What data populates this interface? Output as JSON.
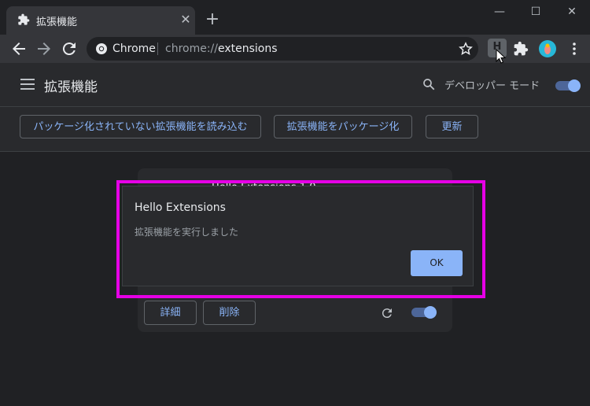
{
  "tab": {
    "title": "拡張機能",
    "close": "✕",
    "new_tab": "+"
  },
  "window_controls": {
    "minimize": "—",
    "maximize": "☐",
    "close": "✕"
  },
  "omnibox": {
    "label": "Chrome",
    "url_prefix": "chrome://",
    "url_path": "extensions"
  },
  "toolbar": {
    "extension_letter": "H"
  },
  "header": {
    "title": "拡張機能",
    "dev_mode_label": "デベロッパー モード",
    "dev_mode_on": true
  },
  "subbar": {
    "load_unpacked": "パッケージ化されていない拡張機能を読み込む",
    "pack": "拡張機能をパッケージ化",
    "update": "更新"
  },
  "card": {
    "title_partial": "Hello Extensions 1.0",
    "details_button": "詳細",
    "remove_button": "削除",
    "enabled": true
  },
  "dialog": {
    "title": "Hello Extensions",
    "message": "拡張機能を実行しました",
    "ok_label": "OK"
  },
  "colors": {
    "accent": "#8ab4f8",
    "highlight": "#e600e6"
  }
}
